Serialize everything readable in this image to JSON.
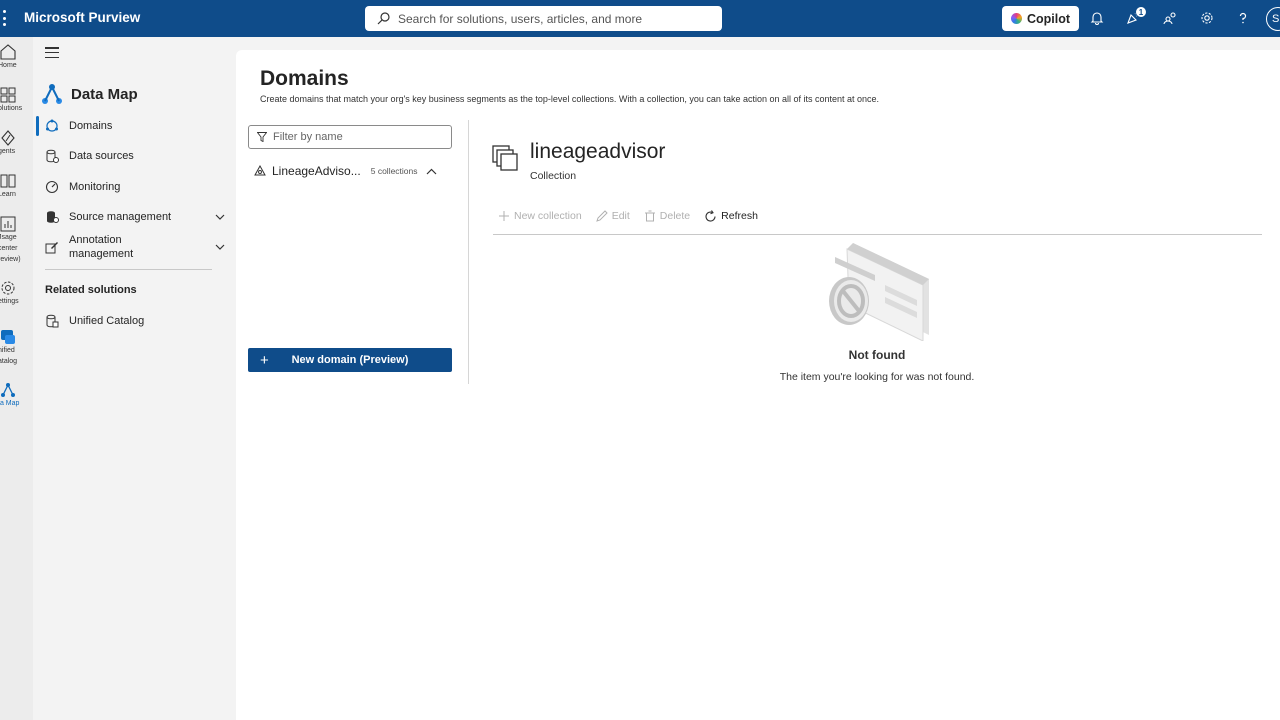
{
  "topbar": {
    "app_title": "Microsoft Purview",
    "search_placeholder": "Search for solutions, users, articles, and more",
    "copilot_label": "Copilot",
    "notification_count": "1",
    "avatar_initial": "S"
  },
  "rail": {
    "items": [
      {
        "label": "Home"
      },
      {
        "label": "olutions"
      },
      {
        "label": "gents"
      },
      {
        "label": "Learn"
      },
      {
        "label": "Jsage\ncenter\nreview)"
      },
      {
        "label": "ettings"
      },
      {
        "label": "nified\natalog"
      },
      {
        "label": "ta Map"
      }
    ]
  },
  "nav": {
    "title": "Data Map",
    "items": [
      {
        "label": "Domains"
      },
      {
        "label": "Data sources"
      },
      {
        "label": "Monitoring"
      },
      {
        "label": "Source management"
      },
      {
        "label": "Annotation management"
      }
    ],
    "related_title": "Related solutions",
    "related_items": [
      {
        "label": "Unified Catalog"
      }
    ]
  },
  "main": {
    "title": "Domains",
    "description": "Create domains that match your org's key business segments as the top-level collections. With a collection, you can take action on all of its content at once.",
    "filter_placeholder": "Filter by name",
    "domain": {
      "name": "LineageAdviso...",
      "collections": "5 collections"
    },
    "new_domain_label": "New domain (Preview)",
    "detail": {
      "title": "lineageadvisor",
      "subtitle": "Collection",
      "toolbar": {
        "new_collection": "New collection",
        "edit": "Edit",
        "delete": "Delete",
        "refresh": "Refresh"
      },
      "empty_title": "Not found",
      "empty_desc": "The item you're looking for was not found."
    }
  },
  "colors": {
    "brand": "#0f4c8a",
    "accent": "#0f6cbd"
  }
}
